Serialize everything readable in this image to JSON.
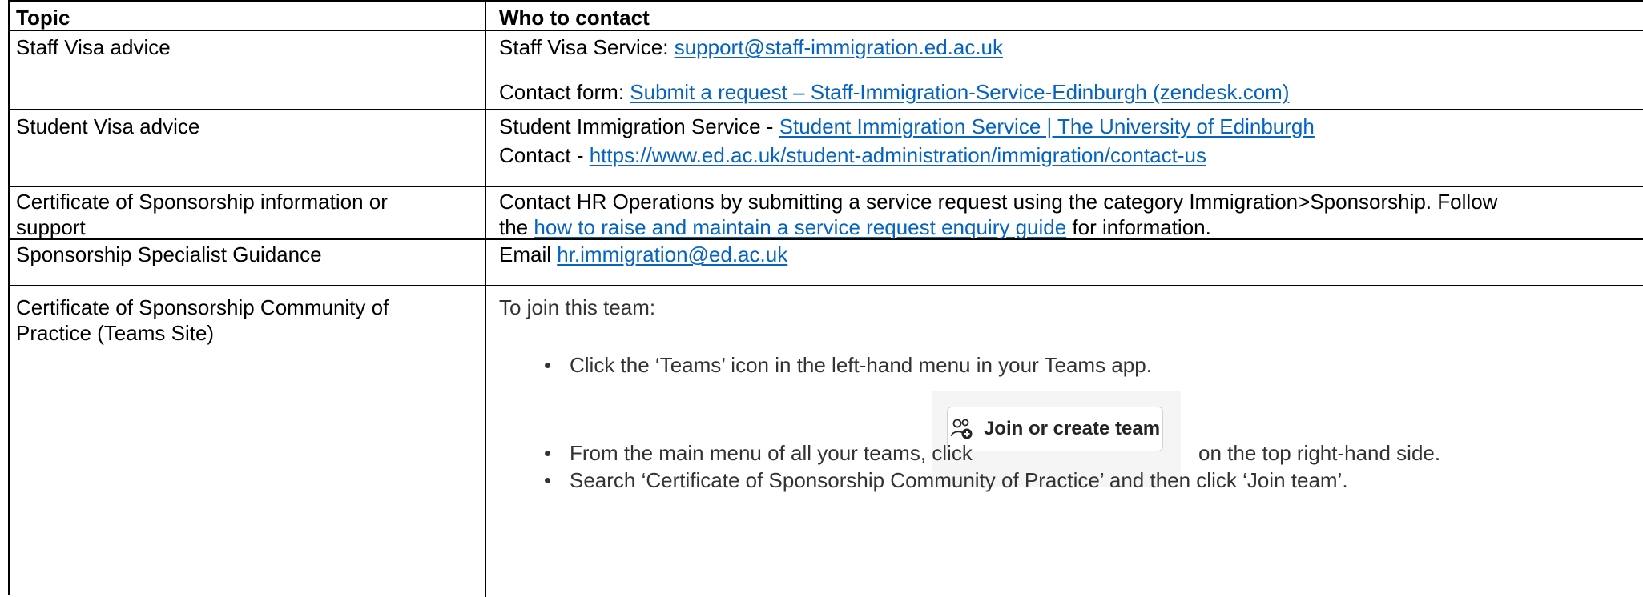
{
  "header": {
    "topic": "Topic",
    "who": "Who to contact"
  },
  "rows": [
    {
      "topic": "Staff Visa advice",
      "line1_prefix": "Staff Visa Service: ",
      "line1_link": "support@staff-immigration.ed.ac.uk",
      "line2_prefix": "Contact form: ",
      "line2_link": "Submit a request –  Staff-Immigration-Service-Edinburgh (zendesk.com)"
    },
    {
      "topic": "Student Visa advice",
      "line1_prefix": "Student Immigration Service  - ",
      "line1_link": "Student Immigration Service | The University of Edinburgh",
      "line2_prefix": "Contact  - ",
      "line2_link": "https://www.ed.ac.uk/student-administration/immigration/contact-us"
    },
    {
      "topic_line1": "Certificate of Sponsorship information or",
      "topic_line2": "support",
      "line1": "Contact HR Operations by submitting a service request using the category Immigration>Sponsorship. Follow",
      "line2_prefix": "the ",
      "line2_link": "how to raise and maintain a service request enquiry guide",
      "line2_suffix": " for information."
    },
    {
      "topic": "Sponsorship Specialist Guidance",
      "line1_prefix": "Email ",
      "line1_link": "hr.immigration@ed.ac.uk"
    },
    {
      "topic_line1": "Certificate of Sponsorship Community of",
      "topic_line2": "Practice (Teams Site)",
      "intro": "To join this team:",
      "bullets": [
        "Click the ‘Teams’ icon in the left-hand menu in your Teams app.",
        "From the main menu of all your teams, click",
        "Search ‘Certificate of Sponsorship Community of Practice’ and then click ‘Join team’."
      ],
      "bullet2_suffix": "on the top right-hand side.",
      "join_button_label": "Join or create team",
      "join_button_icon": "people-add-icon"
    }
  ],
  "colors": {
    "link": "#0563C1",
    "border": "#000000"
  }
}
